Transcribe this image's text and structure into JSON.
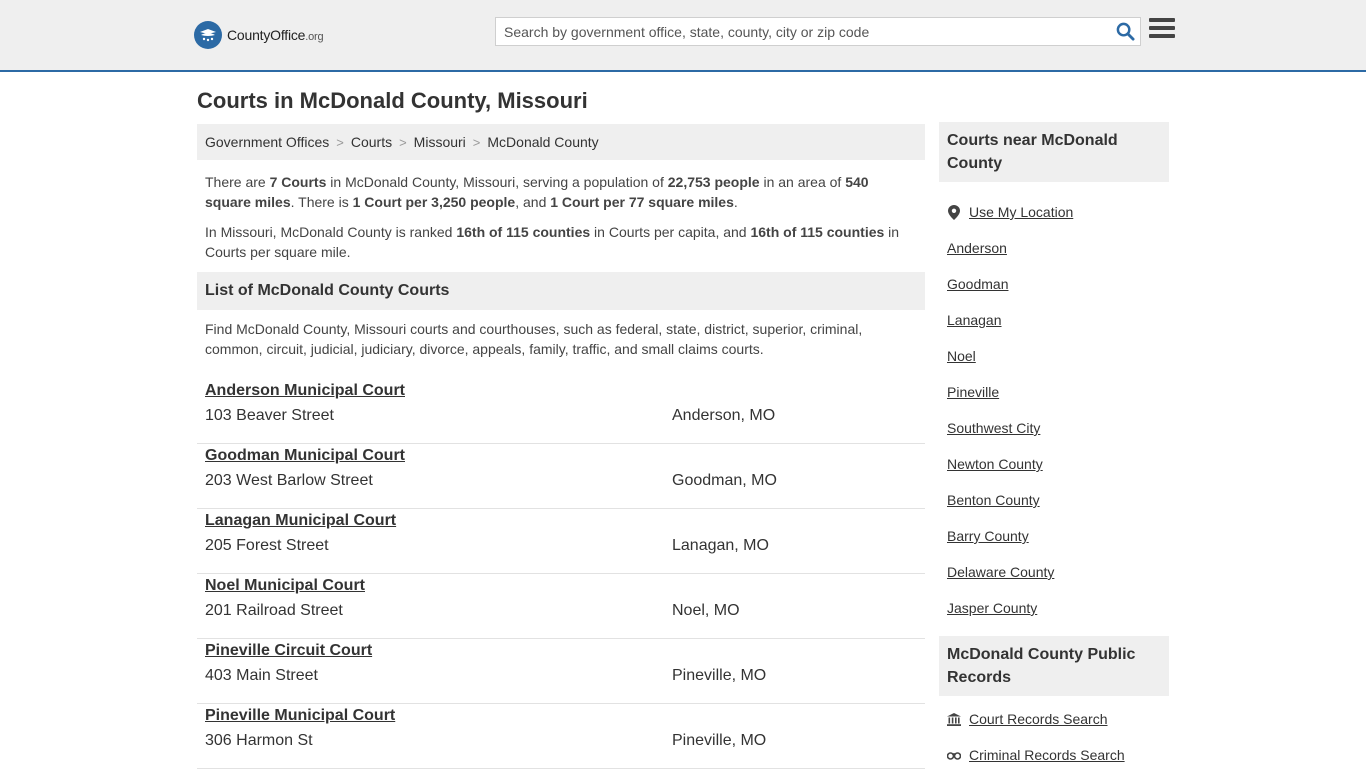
{
  "header": {
    "logo_main": "CountyOffice",
    "logo_tld": ".org",
    "search_placeholder": "Search by government office, state, county, city or zip code"
  },
  "page_title": "Courts in McDonald County, Missouri",
  "breadcrumb": [
    "Government Offices",
    "Courts",
    "Missouri",
    "McDonald County"
  ],
  "intro": {
    "p1": [
      "There are ",
      "7 Courts",
      " in McDonald County, Missouri, serving a population of ",
      "22,753 people",
      " in an area of ",
      "540 square miles",
      ". There is ",
      "1 Court per 3,250 people",
      ", and ",
      "1 Court per 77 square miles",
      "."
    ],
    "p2": [
      "In Missouri, McDonald County is ranked ",
      "16th of 115 counties",
      " in Courts per capita, and ",
      "16th of 115 counties",
      " in Courts per square mile."
    ]
  },
  "list_section": {
    "heading": "List of McDonald County Courts",
    "description": "Find McDonald County, Missouri courts and courthouses, such as federal, state, district, superior, criminal, common, circuit, judicial, judiciary, divorce, appeals, family, traffic, and small claims courts."
  },
  "courts": [
    {
      "name": "Anderson Municipal Court",
      "address": "103 Beaver Street",
      "city": "Anderson, MO"
    },
    {
      "name": "Goodman Municipal Court",
      "address": "203 West Barlow Street",
      "city": "Goodman, MO"
    },
    {
      "name": "Lanagan Municipal Court",
      "address": "205 Forest Street",
      "city": "Lanagan, MO"
    },
    {
      "name": "Noel Municipal Court",
      "address": "201 Railroad Street",
      "city": "Noel, MO"
    },
    {
      "name": "Pineville Circuit Court",
      "address": "403 Main Street",
      "city": "Pineville, MO"
    },
    {
      "name": "Pineville Municipal Court",
      "address": "306 Harmon St",
      "city": "Pineville, MO"
    }
  ],
  "sidebar": {
    "nearby_heading": "Courts near McDonald County",
    "use_location": "Use My Location",
    "nearby_links": [
      "Anderson",
      "Goodman",
      "Lanagan",
      "Noel",
      "Pineville",
      "Southwest City",
      "Newton County",
      "Benton County",
      "Barry County",
      "Delaware County",
      "Jasper County"
    ],
    "records_heading": "McDonald County Public Records",
    "records_links": [
      "Court Records Search",
      "Criminal Records Search"
    ]
  },
  "colors": {
    "brand_blue": "#2c6aa5",
    "panel_gray": "#efefef"
  }
}
